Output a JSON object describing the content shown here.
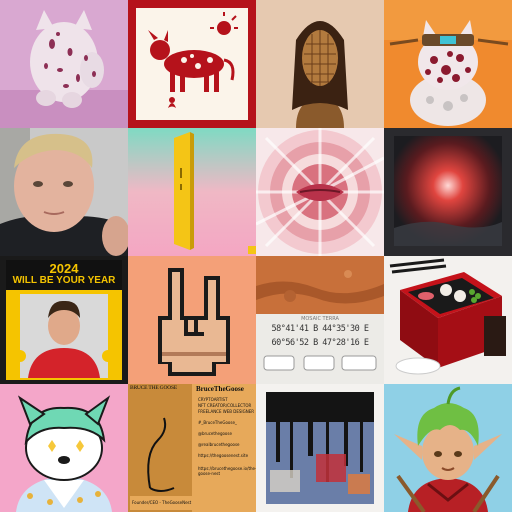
{
  "gallery": {
    "tiles": [
      {
        "id": "ceramic-spotted-cat-figure"
      },
      {
        "id": "red-patterned-cow-print"
      },
      {
        "id": "textured-bronze-bust"
      },
      {
        "id": "floral-cat-robot-character"
      },
      {
        "id": "blond-person-selfie"
      },
      {
        "id": "pastel-gradient-yellow-card"
      },
      {
        "id": "radial-pink-lips-abstract"
      },
      {
        "id": "red-burst-textured-canvas"
      },
      {
        "id": "year-poster",
        "headline_year": "2024",
        "headline_text": "WILL BE YOUR YEAR"
      },
      {
        "id": "pixel-rock-hand"
      },
      {
        "id": "mars-coordinates-card",
        "label": "MOSAIC TERRA",
        "coords_line1": "58°41'41 B 44°35'30 E",
        "coords_line2": "60°56'52 B 47°28'16 E"
      },
      {
        "id": "bento-box-illustration"
      },
      {
        "id": "mint-dog-character"
      },
      {
        "id": "bruce-the-goose-profile",
        "left_title": "BRUCE THE GOOSE",
        "name": "BruceTheGoose",
        "role_line1": "CRYPTOARTIST",
        "role_line2": "NFT CREATOR/COLLECTOR",
        "role_line3": "FREELANCE WEB DESIGNER",
        "links": [
          "#_BruceTheGoose_",
          "@brucethegoose",
          "@realbrucethegoose",
          "https://thegoosenest.site",
          "https://brucethegoose.io/the-goose-nest"
        ],
        "footer": "Founder/CEO - TheGooseNest"
      },
      {
        "id": "dripping-abstract-painting"
      },
      {
        "id": "green-haired-elf-warrior"
      }
    ]
  },
  "colors": {
    "poster_yellow": "#f5c400",
    "cow_red": "#b5121b",
    "elf_red": "#b72025",
    "sky_green": "#6fbf43"
  }
}
